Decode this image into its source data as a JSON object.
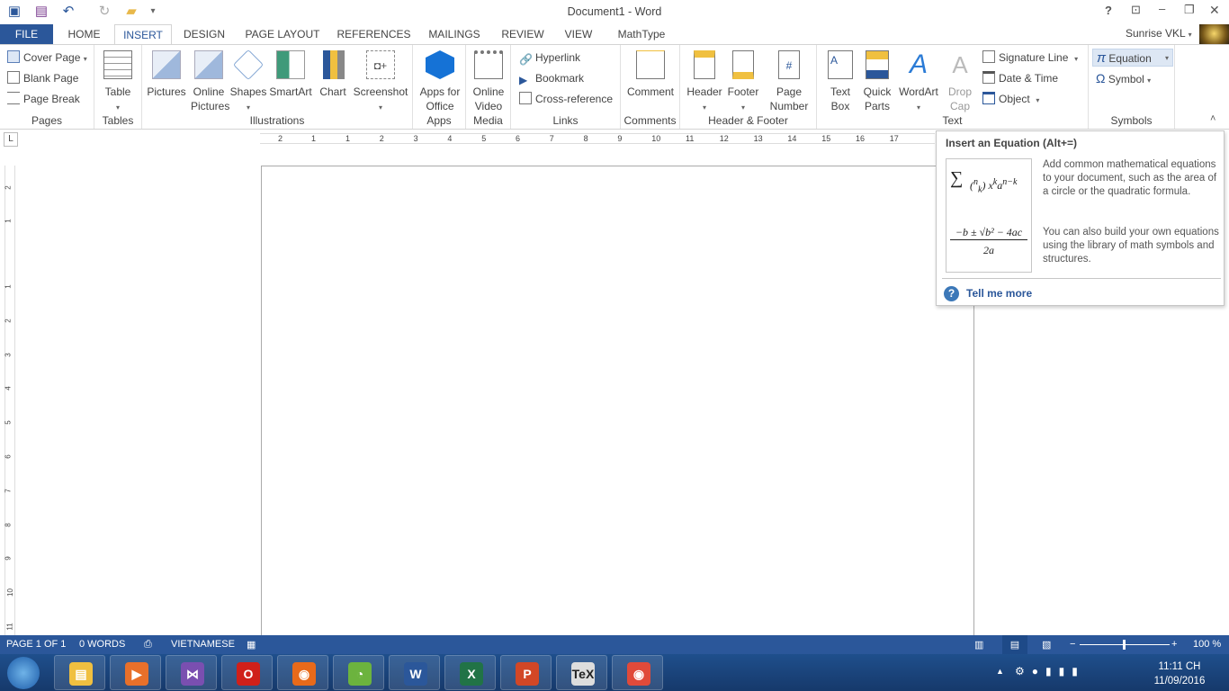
{
  "window": {
    "title": "Document1 - Word",
    "user": "Sunrise VKL",
    "help": "?"
  },
  "quick_access": {
    "icons": [
      "word-logo-icon",
      "save-icon",
      "undo-icon",
      "redo-icon",
      "open-folder-icon",
      "customize-icon"
    ]
  },
  "tabs": [
    "FILE",
    "HOME",
    "INSERT",
    "DESIGN",
    "PAGE LAYOUT",
    "REFERENCES",
    "MAILINGS",
    "REVIEW",
    "VIEW",
    "MathType"
  ],
  "active_tab": "INSERT",
  "ribbon": {
    "pages": {
      "label": "Pages",
      "items": [
        "Cover Page",
        "Blank Page",
        "Page Break"
      ]
    },
    "tables": {
      "label": "Tables",
      "items": [
        "Table"
      ]
    },
    "illustrations": {
      "label": "Illustrations",
      "items": [
        "Pictures",
        "Online Pictures",
        "Shapes",
        "SmartArt",
        "Chart",
        "Screenshot"
      ]
    },
    "apps": {
      "label": "Apps",
      "items": [
        "Apps for Office"
      ]
    },
    "media": {
      "label": "Media",
      "items": [
        "Online Video"
      ]
    },
    "links": {
      "label": "Links",
      "items": [
        "Hyperlink",
        "Bookmark",
        "Cross-reference"
      ]
    },
    "comments": {
      "label": "Comments",
      "items": [
        "Comment"
      ]
    },
    "header_footer": {
      "label": "Header & Footer",
      "items": [
        "Header",
        "Footer",
        "Page Number"
      ]
    },
    "text": {
      "label": "Text",
      "items": [
        "Text Box",
        "Quick Parts",
        "WordArt",
        "Drop Cap",
        "Signature Line",
        "Date & Time",
        "Object"
      ]
    },
    "symbols": {
      "label": "Symbols",
      "items": [
        "Equation",
        "Symbol"
      ]
    }
  },
  "ruler": {
    "h_ticks": [
      "2",
      "1",
      "1",
      "2",
      "3",
      "4",
      "5",
      "6",
      "7",
      "8",
      "9",
      "10",
      "11",
      "12",
      "13",
      "14",
      "15",
      "16",
      "17"
    ],
    "v_ticks": [
      "2",
      "1",
      "1",
      "2",
      "3",
      "4",
      "5",
      "6",
      "7",
      "8",
      "9",
      "10",
      "11"
    ]
  },
  "tooltip": {
    "title": "Insert an Equation (Alt+=)",
    "desc1": "Add common mathematical equations to your document, such as the area of a circle or the quadratic formula.",
    "desc2": "You can also build your own equations using the library of math symbols and structures.",
    "link": "Tell me more"
  },
  "status": {
    "page": "PAGE 1 OF 1",
    "words": "0 WORDS",
    "language": "VIETNAMESE",
    "zoom": "100 %",
    "zoom_percent": 100
  },
  "taskbar": {
    "apps": [
      "File Explorer",
      "Media Player",
      "Visual Studio",
      "Opera",
      "Firefox",
      "Coc Coc",
      "Word",
      "Excel",
      "PowerPoint",
      "TeX",
      "Chrome"
    ],
    "time": "11:11 CH",
    "date": "11/09/2016"
  },
  "colors": {
    "accent": "#2b579a",
    "status_bar": "#2b579a"
  }
}
